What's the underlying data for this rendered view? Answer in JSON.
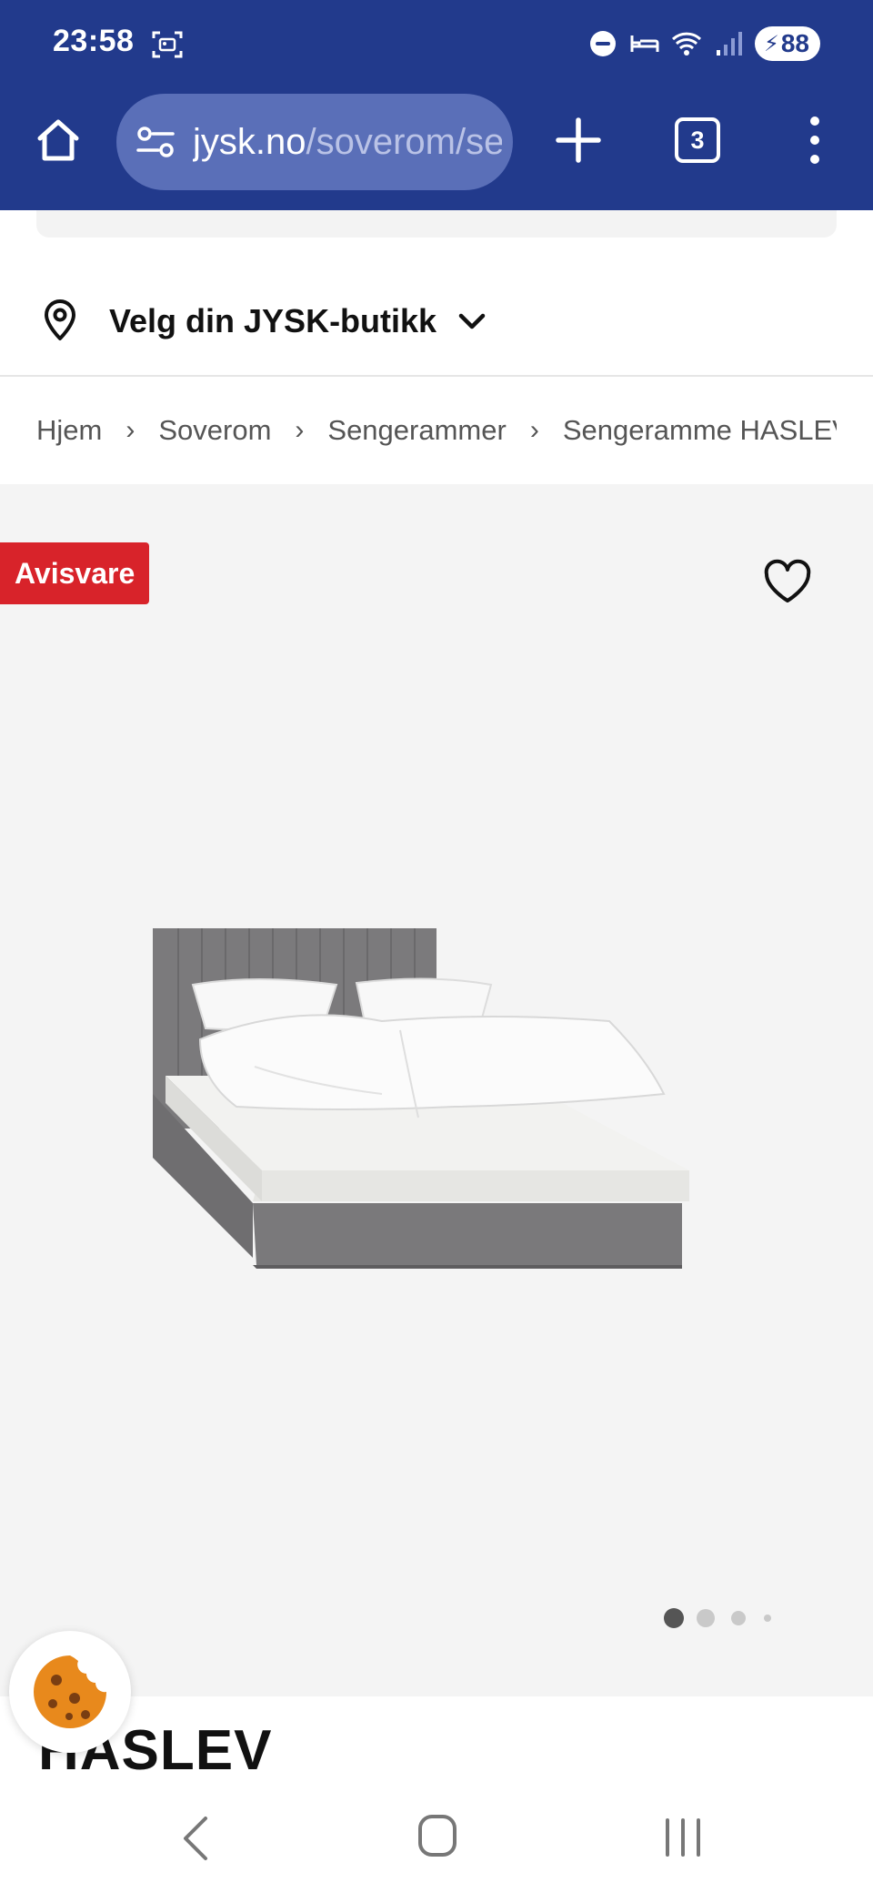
{
  "status_bar": {
    "time": "23:58",
    "battery": "88",
    "icons": [
      "screenshot-icon",
      "do-not-disturb-icon",
      "sleep-mode-icon",
      "wifi-icon",
      "signal-icon",
      "battery-charging-icon"
    ]
  },
  "browser": {
    "url_domain": "jysk.no",
    "url_path": "/soverom/sengerammer",
    "tab_count": "3",
    "icons": [
      "home-icon",
      "site-settings-icon",
      "new-tab-icon",
      "tabs-icon",
      "more-menu-icon"
    ]
  },
  "store": {
    "label": "Velg din JYSK-butikk"
  },
  "breadcrumb": {
    "items": [
      "Hjem",
      "Soverom",
      "Sengerammer",
      "Sengeramme HASLEV"
    ],
    "separator": "›"
  },
  "gallery": {
    "badge": "Avisvare",
    "badge_color": "#d8232a",
    "image_count": 4,
    "active_index": 0
  },
  "product": {
    "title": "HASLEV"
  },
  "colors": {
    "chrome": "#223a8c",
    "urlbar": "#5a6fb8",
    "gallery_bg": "#f4f4f4"
  }
}
